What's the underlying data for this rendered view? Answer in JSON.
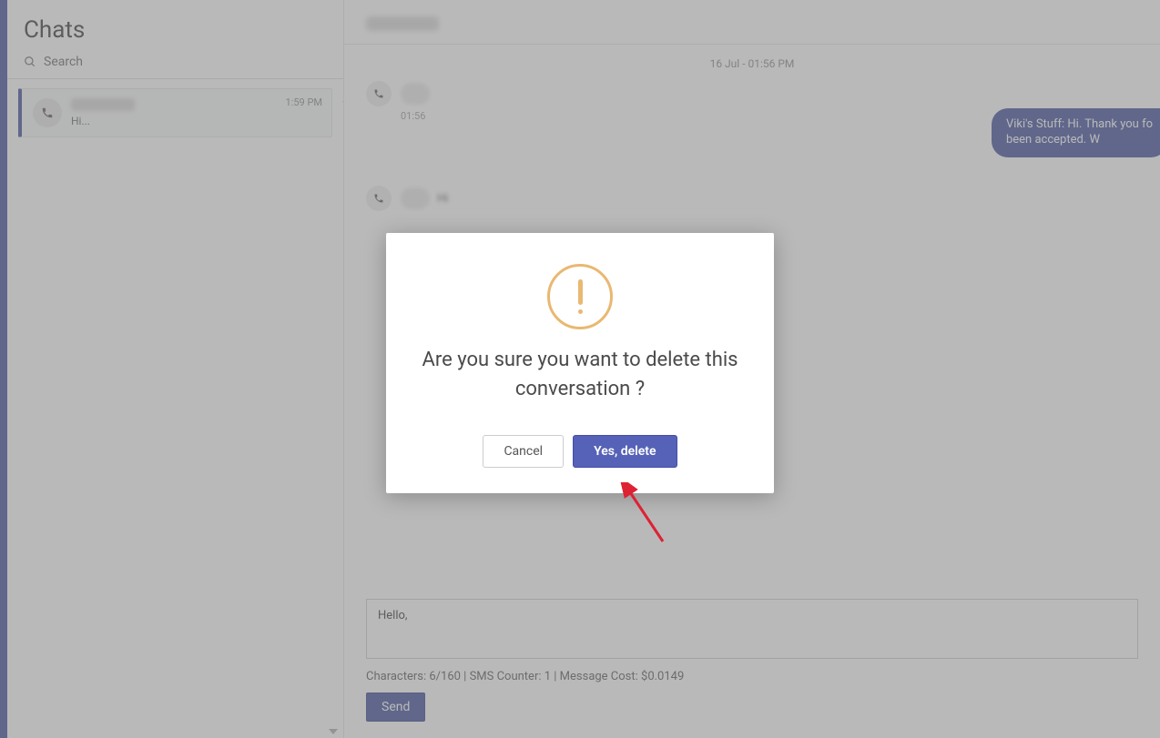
{
  "sidebar": {
    "title": "Chats",
    "search_placeholder": "Search",
    "item": {
      "preview": "Hi...",
      "time": "1:59 PM"
    }
  },
  "conversation": {
    "date_separator": "16 Jul - 01:56 PM",
    "msg1_time": "01:56",
    "msg2_text": "Hi",
    "bubble_right_line1": "Viki's Stuff: Hi. Thank you fo",
    "bubble_right_line2": "been accepted. W"
  },
  "composer": {
    "value": "Hello,",
    "counter": "Characters: 6/160 | SMS Counter: 1 | Message Cost: $0.0149",
    "send_label": "Send"
  },
  "dialog": {
    "message": "Are you sure you want to delete this conversation ?",
    "cancel_label": "Cancel",
    "confirm_label": "Yes, delete"
  }
}
